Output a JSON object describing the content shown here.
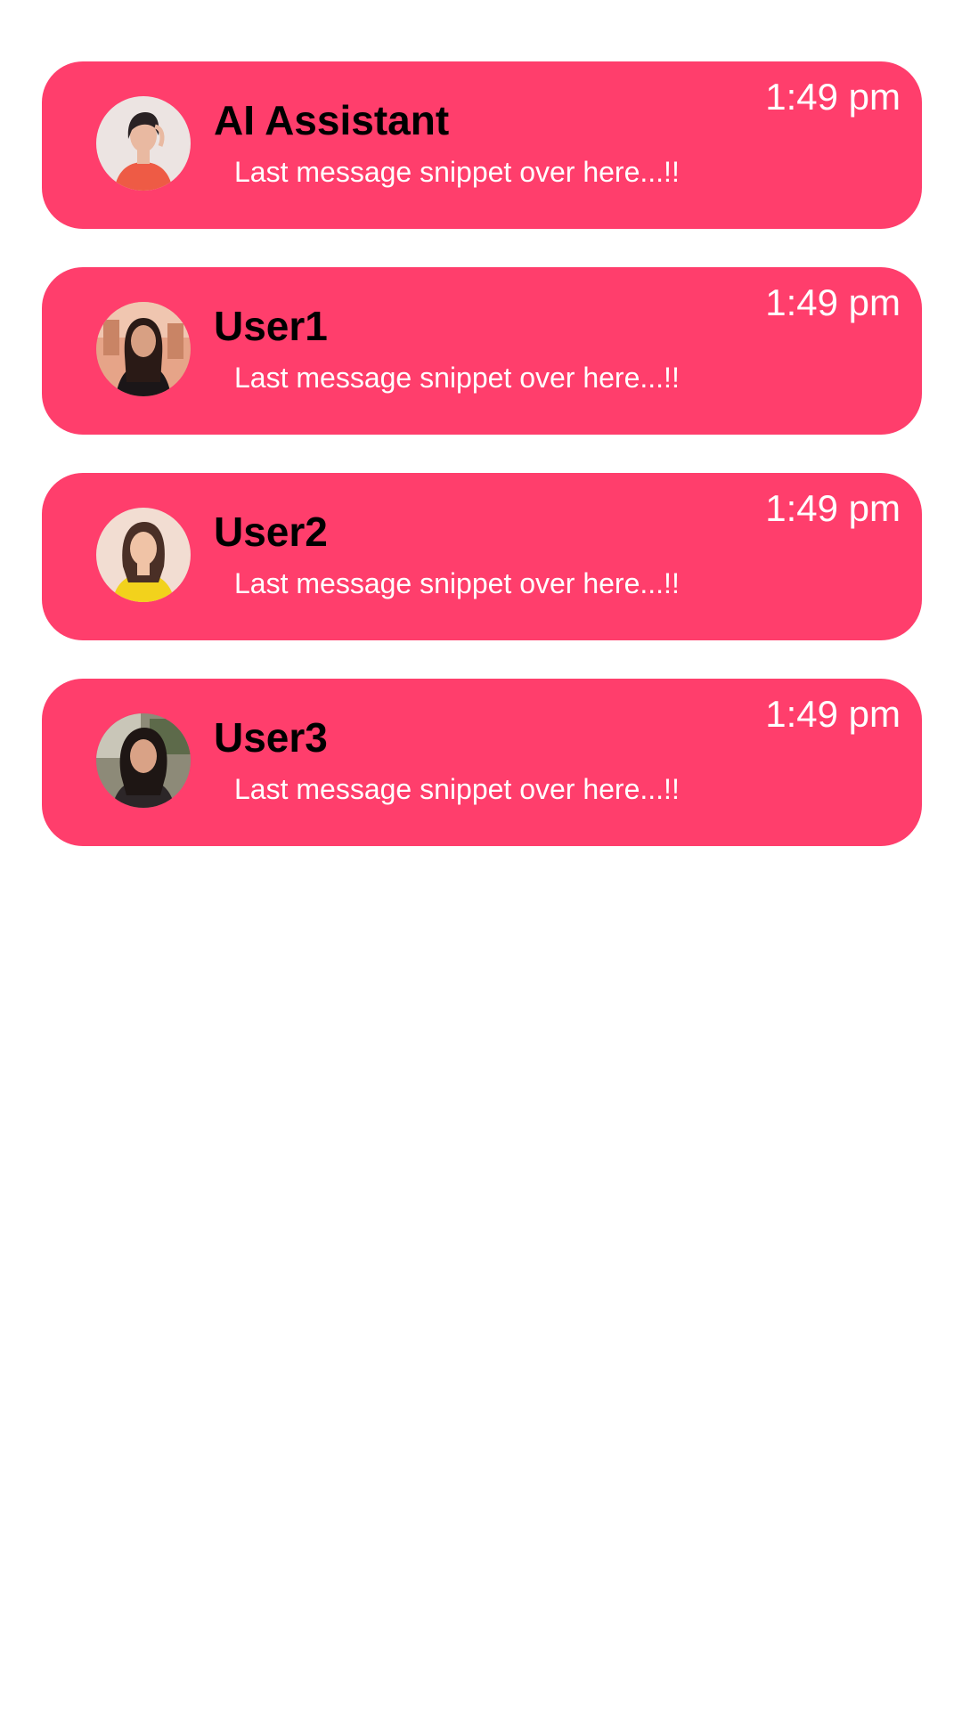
{
  "chats": [
    {
      "name": "AI Assistant",
      "snippet": "Last message snippet over here...!!",
      "time": "1:49 pm",
      "avatar": "avatar-photo-ai-assistant",
      "avatar_colors": {
        "bg": "#ece4e2",
        "hair": "#2a2224",
        "skin": "#e9b9a1",
        "shirt": "#ee5b45"
      }
    },
    {
      "name": "User1",
      "snippet": "Last message snippet over here...!!",
      "time": "1:49 pm",
      "avatar": "avatar-photo-user1",
      "avatar_colors": {
        "bg": "#e6a488",
        "hair": "#2a1a16",
        "skin": "#d8a083",
        "shirt": "#1b1618"
      }
    },
    {
      "name": "User2",
      "snippet": "Last message snippet over here...!!",
      "time": "1:49 pm",
      "avatar": "avatar-photo-user2",
      "avatar_colors": {
        "bg": "#f2ddd2",
        "hair": "#4a2f26",
        "skin": "#f0c3a6",
        "shirt": "#f2d21c"
      }
    },
    {
      "name": "User3",
      "snippet": "Last message snippet over here...!!",
      "time": "1:49 pm",
      "avatar": "avatar-photo-user3",
      "avatar_colors": {
        "bg": "#8d8a78",
        "hair": "#1e1614",
        "skin": "#d9a286",
        "shirt": "#2c2628"
      }
    }
  ],
  "colors": {
    "card_bg": "#ff3e6c",
    "name_text": "#000000",
    "snippet_text": "#ffffff",
    "time_text": "#ffffff",
    "page_bg": "#ffffff"
  }
}
